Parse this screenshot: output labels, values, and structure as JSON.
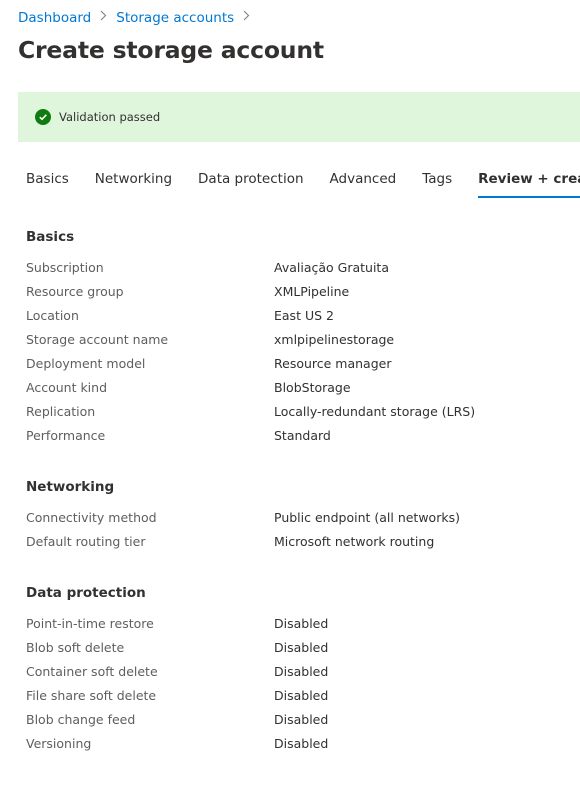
{
  "breadcrumb": {
    "items": [
      {
        "label": "Dashboard"
      },
      {
        "label": "Storage accounts"
      }
    ]
  },
  "page": {
    "title": "Create storage account"
  },
  "validation": {
    "text": "Validation passed",
    "status_color": "#107c10",
    "background_color": "#dff6dd",
    "icon": "check-circle-icon"
  },
  "tabs": [
    {
      "label": "Basics",
      "selected": false
    },
    {
      "label": "Networking",
      "selected": false
    },
    {
      "label": "Data protection",
      "selected": false
    },
    {
      "label": "Advanced",
      "selected": false
    },
    {
      "label": "Tags",
      "selected": false
    },
    {
      "label": "Review + create",
      "selected": true
    }
  ],
  "accent_color": "#0078d4",
  "sections": {
    "basics": {
      "heading": "Basics",
      "rows": [
        {
          "label": "Subscription",
          "value": "Avaliação Gratuita"
        },
        {
          "label": "Resource group",
          "value": "XMLPipeline"
        },
        {
          "label": "Location",
          "value": "East US 2"
        },
        {
          "label": "Storage account name",
          "value": "xmlpipelinestorage"
        },
        {
          "label": "Deployment model",
          "value": "Resource manager"
        },
        {
          "label": "Account kind",
          "value": "BlobStorage"
        },
        {
          "label": "Replication",
          "value": "Locally-redundant storage (LRS)"
        },
        {
          "label": "Performance",
          "value": "Standard"
        }
      ]
    },
    "networking": {
      "heading": "Networking",
      "rows": [
        {
          "label": "Connectivity method",
          "value": "Public endpoint (all networks)"
        },
        {
          "label": "Default routing tier",
          "value": "Microsoft network routing"
        }
      ]
    },
    "data_protection": {
      "heading": "Data protection",
      "rows": [
        {
          "label": "Point-in-time restore",
          "value": "Disabled"
        },
        {
          "label": "Blob soft delete",
          "value": "Disabled"
        },
        {
          "label": "Container soft delete",
          "value": "Disabled"
        },
        {
          "label": "File share soft delete",
          "value": "Disabled"
        },
        {
          "label": "Blob change feed",
          "value": "Disabled"
        },
        {
          "label": "Versioning",
          "value": "Disabled"
        }
      ]
    }
  }
}
